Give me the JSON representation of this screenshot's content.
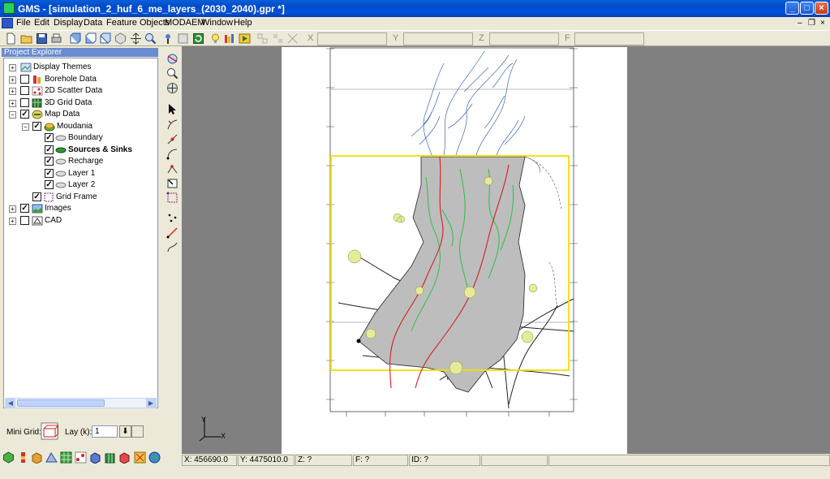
{
  "window": {
    "title": "GMS - [simulation_2_huf_6_me_layers_(2030_2040).gpr *]",
    "buttons": {
      "minimize": "_",
      "maximize": "□",
      "close": "×"
    }
  },
  "menu": [
    "File",
    "Edit",
    "Display",
    "Data",
    "Feature Objects",
    "MODAEM",
    "Window",
    "Help"
  ],
  "mdi_buttons": {
    "minimize": "–",
    "restore": "❐",
    "close": "×"
  },
  "toolbar": {
    "coords": [
      {
        "label": "X",
        "value": ""
      },
      {
        "label": "Y",
        "value": ""
      },
      {
        "label": "Z",
        "value": ""
      },
      {
        "label": "F",
        "value": ""
      }
    ]
  },
  "explorer": {
    "title": "Project Explorer",
    "items": [
      {
        "label": "Display Themes",
        "expander": "+",
        "checked": null,
        "icon": "display-themes"
      },
      {
        "label": "Borehole Data",
        "expander": "+",
        "checked": false,
        "icon": "borehole"
      },
      {
        "label": "2D Scatter Data",
        "expander": "+",
        "checked": false,
        "icon": "scatter"
      },
      {
        "label": "3D Grid Data",
        "expander": "+",
        "checked": false,
        "icon": "grid3d"
      },
      {
        "label": "Map Data",
        "expander": "−",
        "checked": true,
        "icon": "map"
      },
      {
        "label": "Moudania",
        "expander": "−",
        "checked": true,
        "icon": "coverage"
      },
      {
        "label": "Boundary",
        "checked": true,
        "icon": "layer"
      },
      {
        "label": "Sources & Sinks",
        "checked": true,
        "icon": "layer-active",
        "bold": true
      },
      {
        "label": "Recharge",
        "checked": true,
        "icon": "layer"
      },
      {
        "label": "Layer 1",
        "checked": true,
        "icon": "layer"
      },
      {
        "label": "Layer 2",
        "checked": true,
        "icon": "layer"
      },
      {
        "label": "Grid Frame",
        "checked": true,
        "icon": "grid-frame"
      },
      {
        "label": "Images",
        "expander": "+",
        "checked": true,
        "icon": "images"
      },
      {
        "label": "CAD",
        "expander": "+",
        "checked": false,
        "icon": "cad"
      }
    ]
  },
  "minigrid": {
    "label": "Mini Grid:",
    "lay_label": "Lay (k):",
    "lay_value": "1"
  },
  "axis": {
    "y": "Y",
    "x": "X"
  },
  "status": {
    "x": "X: 456690.0",
    "y": "Y: 4475010.0",
    "z": "Z: ?",
    "f": "F: ?",
    "id": "ID: ?"
  }
}
